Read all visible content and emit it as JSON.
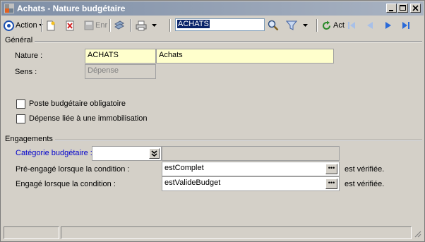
{
  "window": {
    "title": "Achats - Nature budgétaire"
  },
  "toolbar": {
    "action_label": "Action",
    "save_label": "Enr",
    "search_value": "ACHATS",
    "refresh_label": "Act"
  },
  "general": {
    "section_label": "Général",
    "nature_label": "Nature :",
    "nature_code": "ACHATS",
    "nature_name": "Achats",
    "sens_label": "Sens :",
    "sens_value": "Dépense",
    "mandatory_label": "Poste budgétaire obligatoire",
    "mandatory_checked": false,
    "asset_label": "Dépense liée à une immobilisation",
    "asset_checked": false
  },
  "engagements": {
    "section_label": "Engagements",
    "category_label": "Catégorie budgétaire :",
    "category_value": "",
    "category_desc": "",
    "preengage_label": "Pré-engagé lorsque la condition :",
    "preengage_value": "estComplet",
    "preengage_suffix": "est vérifiée.",
    "engage_label": "Engagé lorsque la condition :",
    "engage_value": "estValideBudget",
    "engage_suffix": "est vérifiée."
  },
  "colors": {
    "required_field_bg": "#ffffcc",
    "link_label": "#0000cc",
    "selection_bg": "#0a246a"
  }
}
